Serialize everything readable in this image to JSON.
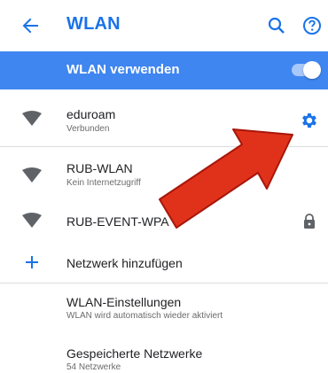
{
  "appbar": {
    "title": "WLAN",
    "back_icon": "arrow-back-icon",
    "search_icon": "search-icon",
    "help_icon": "help-icon",
    "accent_color": "#1a73e8"
  },
  "master": {
    "label": "WLAN verwenden",
    "enabled": true,
    "bar_color": "#3f86f0"
  },
  "networks": [
    {
      "name": "eduroam",
      "status": "Verbunden"
    },
    {
      "name": "RUB-WLAN",
      "status": "Kein Internetzugriff"
    },
    {
      "name": "RUB-EVENT-WPA",
      "status": ""
    }
  ],
  "add_network": {
    "label": "Netzwerk hinzufügen"
  },
  "settings": [
    {
      "title": "WLAN-Einstellungen",
      "subtitle": "WLAN wird automatisch wieder aktiviert"
    },
    {
      "title": "Gespeicherte Netzwerke",
      "subtitle": "54 Netzwerke"
    }
  ],
  "annotation": {
    "arrow_color": "#e0321b"
  }
}
